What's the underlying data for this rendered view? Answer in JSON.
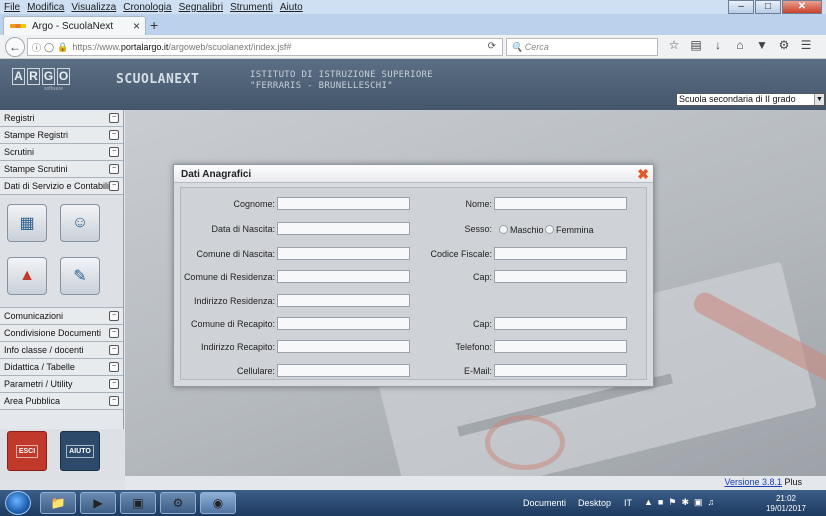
{
  "browser": {
    "menu": [
      "File",
      "Modifica",
      "Visualizza",
      "Cronologia",
      "Segnalibri",
      "Strumenti",
      "Aiuto"
    ],
    "window_controls": [
      "–",
      "□",
      "✕"
    ],
    "tab_title": "Argo - ScuolaNext",
    "tab_close": "×",
    "new_tab": "+",
    "url_prefix": "https://www.",
    "url_host": "portalargo.it",
    "url_path": "/argoweb/scuolanext/index.jsf#",
    "search_placeholder": "Cerca",
    "back_icon": "arrow-left-icon",
    "nav_icons": [
      "star-icon",
      "library-icon",
      "download-icon",
      "home-icon",
      "pocket-icon",
      "extension-icon",
      "menu-icon"
    ]
  },
  "header": {
    "logo_letters": [
      "A",
      "R",
      "G",
      "O"
    ],
    "logo_sub": "software",
    "brand": "SCUOLANEXT",
    "institute_line1": "ISTITUTO DI ISTRUZIONE SUPERIORE",
    "institute_line2": "\"FERRARIS - BRUNELLESCHI\"",
    "school_select": "Scuola secondaria di II grado"
  },
  "sidebar": {
    "items_top": [
      "Registri",
      "Stampe Registri",
      "Scrutini",
      "Stampe Scrutini",
      "Dati di Servizio e Contabili"
    ],
    "items_bottom": [
      "Comunicazioni",
      "Condivisione Documenti",
      "Info classe / docenti",
      "Didattica / Tabelle",
      "Parametri / Utility",
      "Area Pubblica"
    ],
    "toggle": "−",
    "panel_icons": [
      "id-card-icon",
      "group-icon",
      "pdf-icon",
      "edit-user-icon"
    ],
    "exit_label": "ESCI",
    "help_label": "AIUTO"
  },
  "footer": {
    "version_link": "Versione 3.8.1",
    "version_suffix": " Plus"
  },
  "dialog": {
    "title": "Dati Anagrafici",
    "close": "✖",
    "labels": {
      "cognome": "Cognome:",
      "nome": "Nome:",
      "data_nascita": "Data di Nascita:",
      "sesso": "Sesso:",
      "maschio": "Maschio",
      "femmina": "Femmina",
      "comune_nascita": "Comune di Nascita:",
      "codice_fiscale": "Codice Fiscale:",
      "comune_residenza": "Comune di Residenza:",
      "cap": "Cap:",
      "indirizzo_residenza": "Indirizzo Residenza:",
      "comune_recapito": "Comune di Recapito:",
      "cap2": "Cap:",
      "indirizzo_recapito": "Indirizzo Recapito:",
      "telefono": "Telefono:",
      "cellulare": "Cellulare:",
      "email": "E-Mail:"
    }
  },
  "taskbar": {
    "documenti": "Documenti",
    "desktop": "Desktop",
    "lang": "IT",
    "time": "21:02",
    "date": "19/01/2017"
  }
}
